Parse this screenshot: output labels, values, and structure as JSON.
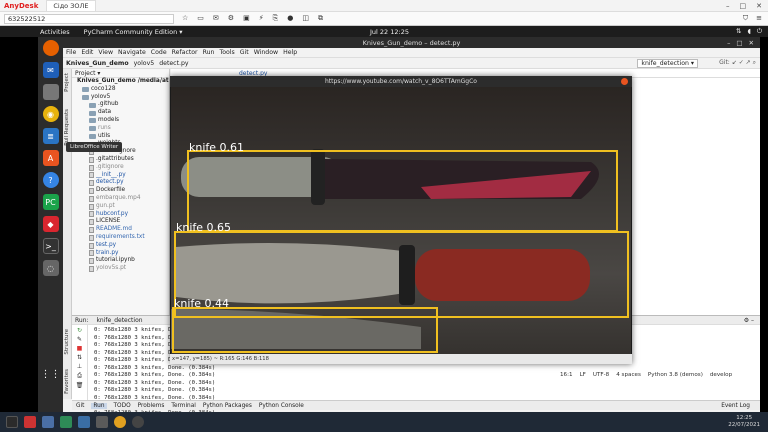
{
  "anydesk": {
    "app_name": "AnyDesk",
    "tab_label": "Сідо ЗОЛЕ",
    "address": "632522512"
  },
  "ubuntu": {
    "activities": "Activities",
    "app_menu": "PyCharm Community Edition ▾",
    "clock": "Jul 22  12:25"
  },
  "tooltip": "LibreOffice Writer",
  "pycharm": {
    "title": "Knives_Gun_demo – detect.py",
    "menu": [
      "File",
      "Edit",
      "View",
      "Navigate",
      "Code",
      "Refactor",
      "Run",
      "Tools",
      "Git",
      "Window",
      "Help"
    ],
    "breadcrumb": [
      "Knives_Gun_demo",
      "yolov5",
      "detect.py"
    ],
    "run_config": "knife_detection ▾",
    "git_label": "Git:",
    "editor_tab": "detect.py",
    "project_header": "Project ▾",
    "side_tabs": [
      "Project",
      "Pull Requests",
      "Structure",
      "Favorites"
    ],
    "tree": [
      {
        "label": "Knives_Gun_demo  /media/atun...",
        "kind": "root",
        "indent": 0
      },
      {
        "label": "coco128",
        "kind": "folder",
        "indent": 1
      },
      {
        "label": "yolov5",
        "kind": "folder",
        "indent": 1
      },
      {
        "label": ".github",
        "kind": "folder",
        "indent": 2
      },
      {
        "label": "data",
        "kind": "folder",
        "indent": 2
      },
      {
        "label": "models",
        "kind": "folder",
        "indent": 2
      },
      {
        "label": "runs",
        "kind": "folder-gray",
        "indent": 2
      },
      {
        "label": "utils",
        "kind": "folder",
        "indent": 2
      },
      {
        "label": "weights",
        "kind": "folder",
        "indent": 2
      },
      {
        "label": ".dockerignore",
        "kind": "file",
        "indent": 2
      },
      {
        "label": ".gitattributes",
        "kind": "file",
        "indent": 2
      },
      {
        "label": ".gitignore",
        "kind": "file-gray",
        "indent": 2
      },
      {
        "label": "__init__.py",
        "kind": "py",
        "indent": 2
      },
      {
        "label": "detect.py",
        "kind": "py",
        "indent": 2
      },
      {
        "label": "Dockerfile",
        "kind": "file",
        "indent": 2
      },
      {
        "label": "embarque.mp4",
        "kind": "file-gray",
        "indent": 2
      },
      {
        "label": "gun.pt",
        "kind": "file-gray",
        "indent": 2
      },
      {
        "label": "hubconf.py",
        "kind": "py",
        "indent": 2
      },
      {
        "label": "LICENSE",
        "kind": "file",
        "indent": 2
      },
      {
        "label": "README.md",
        "kind": "file-blue",
        "indent": 2
      },
      {
        "label": "requirements.txt",
        "kind": "file-blue",
        "indent": 2
      },
      {
        "label": "test.py",
        "kind": "py",
        "indent": 2
      },
      {
        "label": "train.py",
        "kind": "py",
        "indent": 2
      },
      {
        "label": "tutorial.ipynb",
        "kind": "file",
        "indent": 2
      },
      {
        "label": "yolov5s.pt",
        "kind": "file-gray",
        "indent": 2
      }
    ],
    "run": {
      "label": "Run:",
      "config": "knife_detection",
      "console_lines": [
        "0: 768x1280 3 knifes, Done. (0.384s)",
        "0: 768x1280 3 knifes, Done. (0.384s)",
        "0: 768x1280 3 knifes, Done. (0.384s)",
        "0: 768x1280 3 knifes, Done. (0.384s)",
        "0: 768x1280 3 knifes, Done. (0.384s)",
        "0: 768x1280 3 knifes, Done. (0.384s)",
        "0: 768x1280 3 knifes, Done. (0.384s)",
        "0: 768x1280 3 knifes, Done. (0.384s)",
        "0: 768x1280 3 knifes, Done. (0.384s)",
        "0: 768x1280 3 knifes, Done. (0.384s)",
        "0: 768x1280 3 knifes, Done. (0.384s)",
        "0: 768x1280 3 knifes, Done. (0.384s)",
        "0: 768x1280 3 knifes, Done. (0.399s)",
        "0: 768x1280 3 knifes, Done. (0.384s)"
      ]
    },
    "bottom_tabs": [
      "Git",
      "Run",
      "TODO",
      "Problems",
      "Terminal",
      "Python Packages",
      "Python Console"
    ],
    "event_log": "Event Log",
    "status": [
      "16:1",
      "LF",
      "UTF-8",
      "4 spaces",
      "Python 3.8 (demos)",
      "develop"
    ]
  },
  "video_window": {
    "title": "https://www.youtube.com/watch_v_8O6TTAmGgCo",
    "info": "x=147, y=185) ~ R:165 G:146 B:118",
    "detections": [
      {
        "label": "knife  0.61",
        "score": 0.61
      },
      {
        "label": "knife  0.65",
        "score": 0.65
      },
      {
        "label": "knife  0.44",
        "score": 0.44
      }
    ]
  },
  "taskbar": {
    "time": "12:25",
    "date": "22/07/2021"
  }
}
